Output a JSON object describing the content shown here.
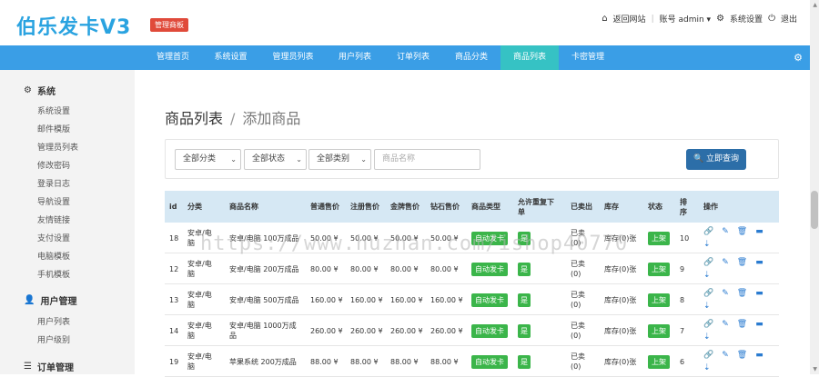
{
  "header": {
    "logo": "伯乐发卡V3",
    "badge": "管理商板",
    "links": {
      "back_site": "返回网站",
      "account": "账号 admin",
      "settings": "系统设置",
      "logout": "退出"
    }
  },
  "nav": {
    "items": [
      "管理首页",
      "系统设置",
      "管理员列表",
      "用户列表",
      "订单列表",
      "商品分类",
      "商品列表",
      "卡密管理"
    ],
    "active": "商品列表"
  },
  "sidebar": {
    "sections": [
      {
        "title": "系统",
        "items": [
          "系统设置",
          "邮件模版",
          "管理员列表",
          "修改密码",
          "登录日志",
          "导航设置",
          "友情链接",
          "支付设置",
          "电脑模板",
          "手机模板"
        ]
      },
      {
        "title": "用户管理",
        "items": [
          "用户列表",
          "用户级别"
        ]
      },
      {
        "title": "订单管理",
        "items": []
      }
    ]
  },
  "breadcrumb": {
    "title": "商品列表",
    "separator": "/",
    "sub": "添加商品"
  },
  "filter": {
    "category": "全部分类",
    "status": "全部状态",
    "type": "全部类别",
    "name_placeholder": "商品名称",
    "query_button": "立即查询"
  },
  "table": {
    "headers": [
      "id",
      "分类",
      "商品名称",
      "普通售价",
      "注册售价",
      "金牌售价",
      "钻石售价",
      "商品类型",
      "允许重复下单",
      "已卖出",
      "库存",
      "状态",
      "排序",
      "操作"
    ],
    "rows": [
      {
        "id": "18",
        "category": "安卓/电脑",
        "name": "安卓/电脑 100万成品",
        "p1": "50.00 ¥",
        "p2": "50.00 ¥",
        "p3": "50.00 ¥",
        "p4": "50.00 ¥",
        "type": "自动发卡",
        "repeat": "是",
        "sold": "已卖(0)",
        "stock": "库存(0)张",
        "status": "上架",
        "sort": "10"
      },
      {
        "id": "12",
        "category": "安卓/电脑",
        "name": "安卓/电脑 200万成品",
        "p1": "80.00 ¥",
        "p2": "80.00 ¥",
        "p3": "80.00 ¥",
        "p4": "80.00 ¥",
        "type": "自动发卡",
        "repeat": "是",
        "sold": "已卖(0)",
        "stock": "库存(0)张",
        "status": "上架",
        "sort": "9"
      },
      {
        "id": "13",
        "category": "安卓/电脑",
        "name": "安卓/电脑 500万成品",
        "p1": "160.00 ¥",
        "p2": "160.00 ¥",
        "p3": "160.00 ¥",
        "p4": "160.00 ¥",
        "type": "自动发卡",
        "repeat": "是",
        "sold": "已卖(0)",
        "stock": "库存(0)张",
        "status": "上架",
        "sort": "8"
      },
      {
        "id": "14",
        "category": "安卓/电脑",
        "name": "安卓/电脑 1000万成品",
        "p1": "260.00 ¥",
        "p2": "260.00 ¥",
        "p3": "260.00 ¥",
        "p4": "260.00 ¥",
        "type": "自动发卡",
        "repeat": "是",
        "sold": "已卖(0)",
        "stock": "库存(0)张",
        "status": "上架",
        "sort": "7"
      },
      {
        "id": "19",
        "category": "安卓/电脑",
        "name": "苹果系统 200万成品",
        "p1": "88.00 ¥",
        "p2": "88.00 ¥",
        "p3": "88.00 ¥",
        "p4": "88.00 ¥",
        "type": "自动发卡",
        "repeat": "是",
        "sold": "已卖(0)",
        "stock": "库存(0)张",
        "status": "上架",
        "sort": "6"
      }
    ]
  },
  "watermark": "https://www.huzhan.com/ishop40770",
  "colors": {
    "brand": "#2aa3e0",
    "nav": "#3a9ee6",
    "nav_active": "#36c2c4",
    "success": "#3bb54a",
    "primary_button": "#2c6ea8"
  }
}
